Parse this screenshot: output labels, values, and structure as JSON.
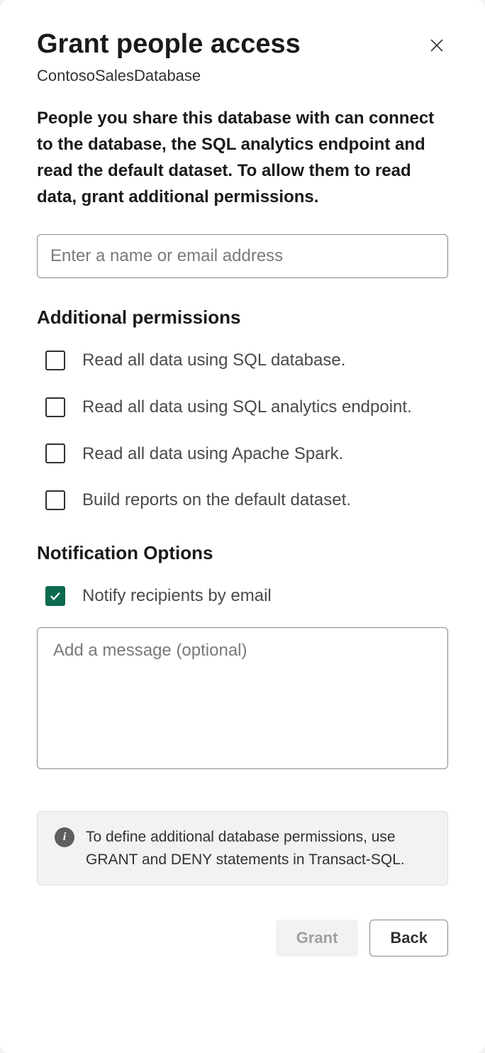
{
  "dialog": {
    "title": "Grant people access",
    "subtitle": "ContosoSalesDatabase",
    "description": "People you share this database with can connect to the database, the SQL analytics endpoint and read the default dataset. To allow them to read data, grant additional permissions.",
    "name_input_placeholder": "Enter a name or email address"
  },
  "permissions": {
    "heading": "Additional permissions",
    "items": [
      {
        "label": "Read all data using SQL database.",
        "checked": false
      },
      {
        "label": "Read all data using SQL analytics endpoint.",
        "checked": false
      },
      {
        "label": "Read all data using Apache Spark.",
        "checked": false
      },
      {
        "label": "Build reports on the default dataset.",
        "checked": false
      }
    ]
  },
  "notification": {
    "heading": "Notification Options",
    "notify_label": "Notify recipients by email",
    "notify_checked": true,
    "message_placeholder": "Add a message (optional)"
  },
  "info": {
    "text": "To define additional database permissions, use GRANT and DENY statements in Transact-SQL."
  },
  "buttons": {
    "grant": "Grant",
    "back": "Back"
  }
}
